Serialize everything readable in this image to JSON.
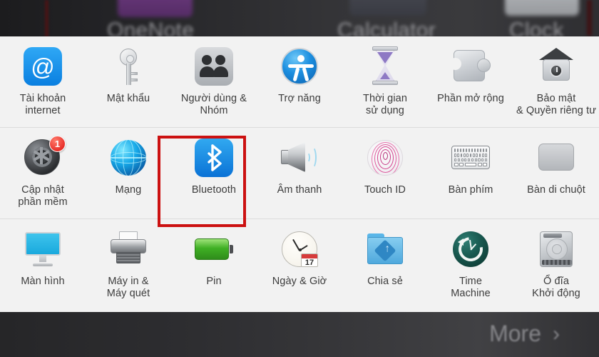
{
  "background": {
    "app_labels": [
      "OneNote",
      "Calculator",
      "Clock"
    ],
    "more_label": "More",
    "more_chevron": "›"
  },
  "panel": {
    "rows": [
      {
        "items": [
          {
            "icon": "internet-accounts-icon",
            "label_lines": [
              "Tài khoản",
              "internet"
            ]
          },
          {
            "icon": "passwords-key-icon",
            "label_lines": [
              "Mật khẩu"
            ]
          },
          {
            "icon": "users-groups-icon",
            "label_lines": [
              "Người dùng &",
              "Nhóm"
            ]
          },
          {
            "icon": "accessibility-icon",
            "label_lines": [
              "Trợ năng"
            ]
          },
          {
            "icon": "screen-time-hourglass-icon",
            "label_lines": [
              "Thời gian",
              "sử dụng"
            ]
          },
          {
            "icon": "extensions-puzzle-icon",
            "label_lines": [
              "Phần mở rộng"
            ]
          },
          {
            "icon": "security-privacy-safe-icon",
            "label_lines": [
              "Bảo mật",
              "& Quyền riêng tư"
            ]
          }
        ]
      },
      {
        "items": [
          {
            "icon": "software-update-gear-icon",
            "label_lines": [
              "Cập nhật",
              "phần mềm"
            ],
            "badge": "1"
          },
          {
            "icon": "network-globe-icon",
            "label_lines": [
              "Mạng"
            ]
          },
          {
            "icon": "bluetooth-icon",
            "label_lines": [
              "Bluetooth"
            ],
            "selected": true
          },
          {
            "icon": "sound-speaker-icon",
            "label_lines": [
              "Âm thanh"
            ]
          },
          {
            "icon": "touch-id-fingerprint-icon",
            "label_lines": [
              "Touch ID"
            ]
          },
          {
            "icon": "keyboard-icon",
            "label_lines": [
              "Bàn phím"
            ]
          },
          {
            "icon": "trackpad-icon",
            "label_lines": [
              "Bàn di chuột"
            ]
          }
        ]
      },
      {
        "items": [
          {
            "icon": "displays-monitor-icon",
            "label_lines": [
              "Màn hình"
            ]
          },
          {
            "icon": "printers-scanners-icon",
            "label_lines": [
              "Máy in &",
              "Máy quét"
            ]
          },
          {
            "icon": "battery-icon",
            "label_lines": [
              "Pin"
            ]
          },
          {
            "icon": "date-time-clock-icon",
            "label_lines": [
              "Ngày & Giờ"
            ],
            "calendar_day": "17"
          },
          {
            "icon": "sharing-folder-icon",
            "label_lines": [
              "Chia sẻ"
            ]
          },
          {
            "icon": "time-machine-icon",
            "label_lines": [
              "Time",
              "Machine"
            ]
          },
          {
            "icon": "startup-disk-icon",
            "label_lines": [
              "Ổ đĩa",
              "Khởi động"
            ]
          }
        ]
      }
    ]
  },
  "annotation": {
    "highlight_color": "#cc1111",
    "highlight_target": "Bluetooth"
  }
}
